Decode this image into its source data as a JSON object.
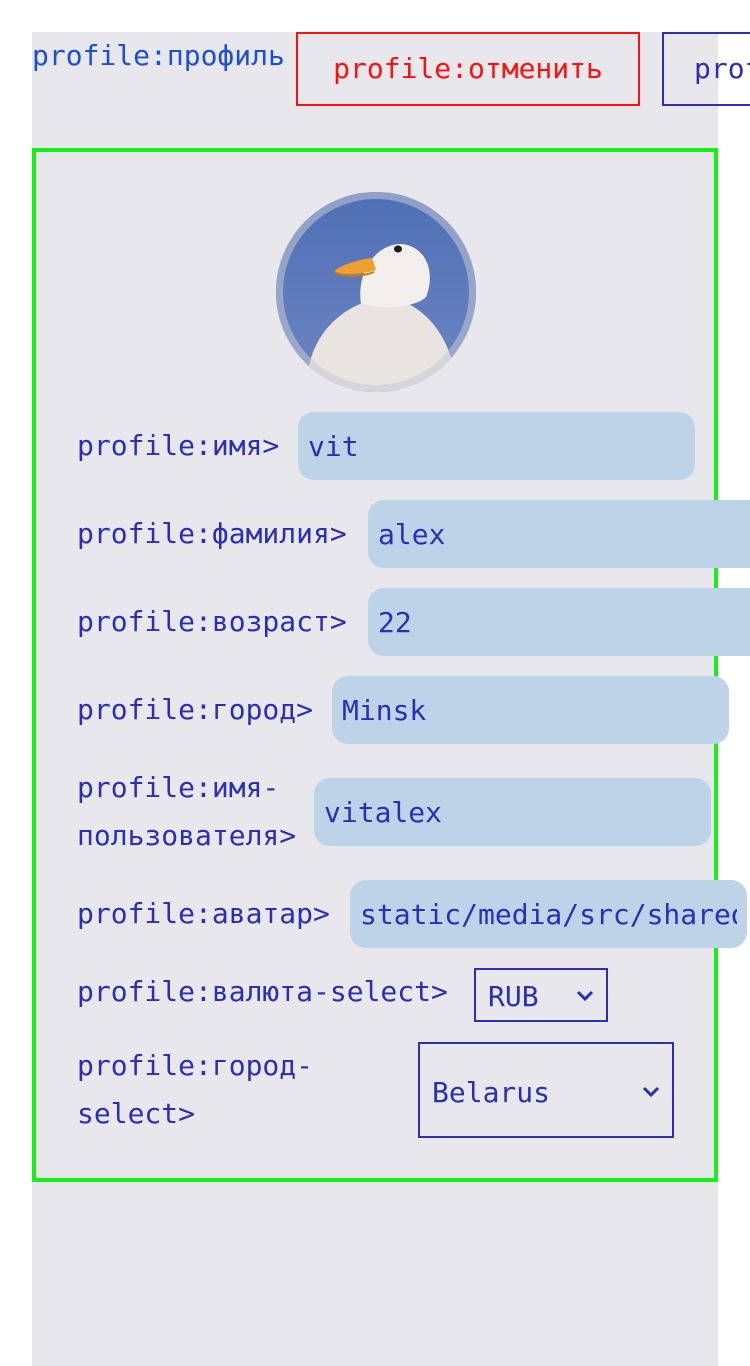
{
  "header": {
    "title": "profile:профиль",
    "cancel_label": "profile:отменить",
    "save_label": "profile:сохранить"
  },
  "avatar": {
    "alt": "duck avatar"
  },
  "form": {
    "first_name": {
      "label": "profile:имя>",
      "value": "vit"
    },
    "last_name": {
      "label": "profile:фамилия>",
      "value": "alex"
    },
    "age": {
      "label": "profile:возраст>",
      "value": "22"
    },
    "city": {
      "label": "profile:город>",
      "value": "Minsk"
    },
    "username": {
      "label_line1": "profile:имя-",
      "label_line2": "пользователя>",
      "value": "vitalex"
    },
    "avatar_path": {
      "label": "profile:аватар>",
      "value": "static/media/src/shared/duck.png"
    },
    "currency": {
      "label": "profile:валюта-select>",
      "value": "RUB"
    },
    "country": {
      "label_line1": "profile:город-",
      "label_line2": "select>",
      "value": "Belarus"
    }
  },
  "colors": {
    "panel_bg": "#e7e7ec",
    "text": "#2b2fb5",
    "title": "#1b4fd6",
    "cancel": "#ff1010",
    "form_border": "#16f016",
    "input_bg": "#bcd3e8"
  }
}
